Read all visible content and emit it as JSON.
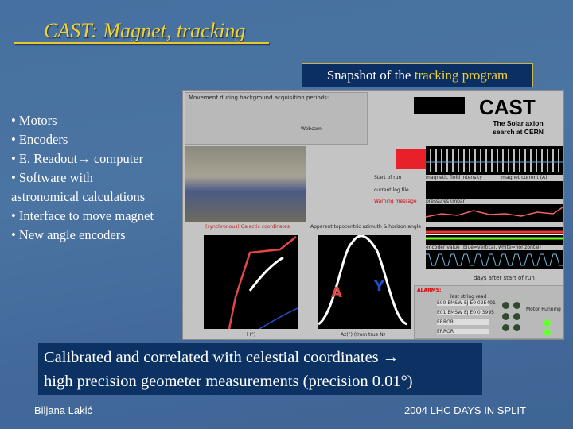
{
  "slide": {
    "title": "CAST: Magnet, tracking",
    "snapshot_caption": {
      "prefix": "Snapshot of the ",
      "highlight": "tracking program"
    },
    "bullets": [
      "• Motors",
      "• Encoders",
      "• E. Readout→ computer",
      "• Software with",
      "astronomical calculations",
      "• Interface to move magnet",
      "• New angle encoders"
    ],
    "bottom_box": {
      "line1": "Calibrated and correlated with celestial coordinates →",
      "line2": "high precision geometer measurements (precision 0.01°)"
    },
    "footer_left": "Biljana Lakić",
    "footer_right": "2004 LHC DAYS IN SPLIT"
  },
  "screenshot": {
    "movement_header": "Movement during background acquisition periods:",
    "logo": "CAST",
    "logo_sub": "The Solar axion search at CERN",
    "webcam_label": "Webcam",
    "start_of_run_label": "Start of run",
    "current_log_label": "current log file",
    "warning_label": "Warning message",
    "magnetic_label": "magnetic field intensity",
    "magnet_current_label": "magnet current (A)",
    "pressures_label": "pressures (mbar)",
    "encoder_label": "encoder value (blue=vertical, white=horizontal)",
    "days_label": "days after start of run",
    "alarms_label": "ALARMS:",
    "last_string_label": "last string read",
    "alarm_strings": [
      "E00 EMSW EJ E0 02E401",
      "E01 EMSW EJ E0 0 3995",
      "ERROR",
      "ERROR"
    ],
    "motor_running_label": "Motor Running",
    "galactic_plot_title": "(synchronous) Galactic coordinates",
    "altaz_plot_title": "Apparent topocentric azimuth & horizon angle",
    "altaz_xlabel": "Az(°) (from true N)",
    "galactic_xlabel": "l (°)",
    "colors": {
      "red_panel": "#e8202a",
      "curve_white": "#ffffff",
      "curve_red": "#e04848",
      "curve_blue": "#2050d0"
    }
  }
}
